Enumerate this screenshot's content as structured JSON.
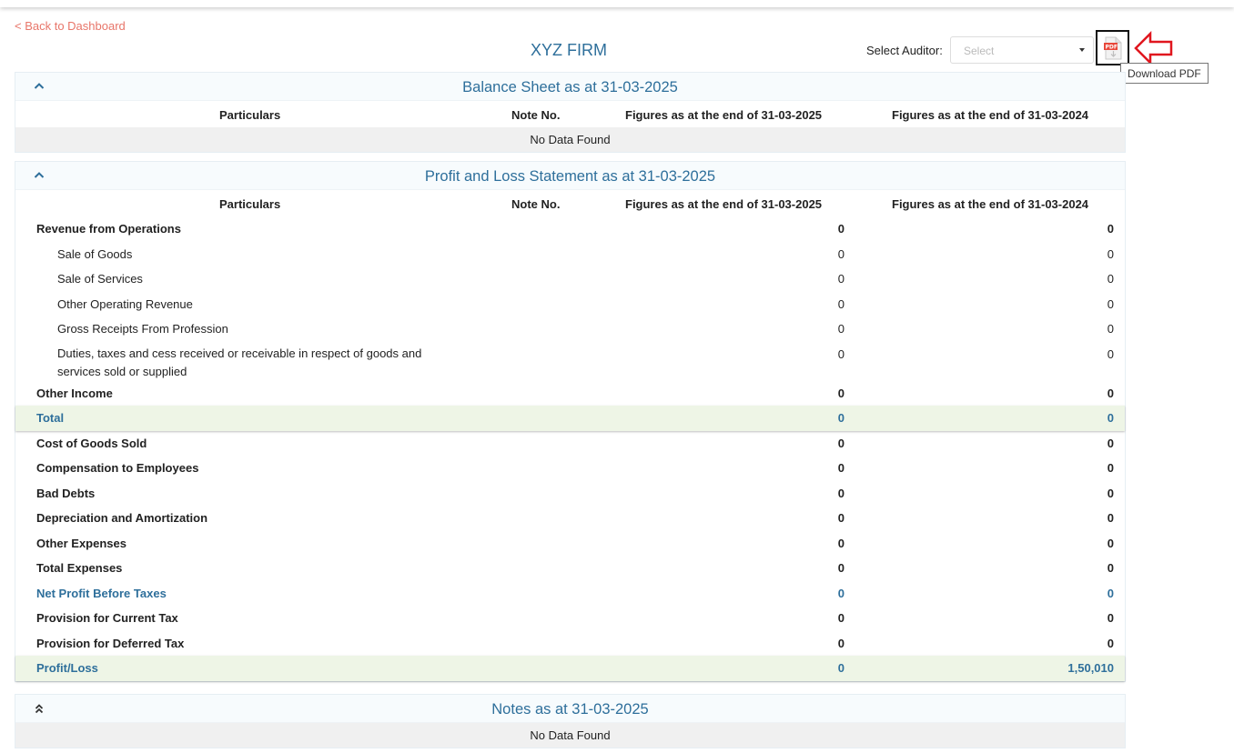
{
  "nav": {
    "back_label": "< Back to Dashboard"
  },
  "header": {
    "firm_name": "XYZ FIRM",
    "auditor_label": "Select Auditor:",
    "auditor_placeholder": "Select",
    "pdf_tooltip": "Download PDF"
  },
  "columns": {
    "particulars": "Particulars",
    "note": "Note No.",
    "fy_current": "Figures as at the end of 31-03-2025",
    "fy_previous": "Figures as at the end of 31-03-2024"
  },
  "balance_sheet": {
    "title": "Balance Sheet as at 31-03-2025",
    "empty_text": "No Data Found"
  },
  "profit_loss": {
    "title": "Profit and Loss Statement as at 31-03-2025",
    "rows": [
      {
        "label": "Revenue from Operations",
        "v1": "0",
        "v2": "0",
        "style": "bold"
      },
      {
        "label": "Sale of Goods",
        "v1": "0",
        "v2": "0",
        "style": "sub"
      },
      {
        "label": "Sale of Services",
        "v1": "0",
        "v2": "0",
        "style": "sub"
      },
      {
        "label": "Other Operating Revenue",
        "v1": "0",
        "v2": "0",
        "style": "sub"
      },
      {
        "label": "Gross Receipts From Profession",
        "v1": "0",
        "v2": "0",
        "style": "sub"
      },
      {
        "label": "Duties, taxes and cess received or receivable in respect of goods and services sold or supplied",
        "v1": "0",
        "v2": "0",
        "style": "sub-tall"
      },
      {
        "label": "Other Income",
        "v1": "0",
        "v2": "0",
        "style": "bold"
      },
      {
        "label": "Total",
        "v1": "0",
        "v2": "0",
        "style": "total"
      },
      {
        "label": "Cost of Goods Sold",
        "v1": "0",
        "v2": "0",
        "style": "bold"
      },
      {
        "label": "Compensation to Employees",
        "v1": "0",
        "v2": "0",
        "style": "bold"
      },
      {
        "label": "Bad Debts",
        "v1": "0",
        "v2": "0",
        "style": "bold"
      },
      {
        "label": "Depreciation and Amortization",
        "v1": "0",
        "v2": "0",
        "style": "bold"
      },
      {
        "label": "Other Expenses",
        "v1": "0",
        "v2": "0",
        "style": "bold"
      },
      {
        "label": "Total Expenses",
        "v1": "0",
        "v2": "0",
        "style": "bold"
      },
      {
        "label": "Net Profit Before Taxes",
        "v1": "0",
        "v2": "0",
        "style": "np"
      },
      {
        "label": "Provision for Current Tax",
        "v1": "0",
        "v2": "0",
        "style": "bold"
      },
      {
        "label": "Provision for Deferred Tax",
        "v1": "0",
        "v2": "0",
        "style": "bold"
      },
      {
        "label": "Profit/Loss",
        "v1": "0",
        "v2": "1,50,010",
        "style": "total"
      }
    ]
  },
  "notes": {
    "title": "Notes as at 31-03-2025",
    "empty_text": "No Data Found"
  },
  "colors": {
    "accent": "#2e6f9b",
    "link": "#e8766a",
    "total_bg": "#eef5e6",
    "annotation_arrow": "#e0161e"
  },
  "icons": {
    "collapse": "chevron-up-icon",
    "expand": "double-chevron-up-icon",
    "pdf": "pdf-download-icon",
    "annotation": "arrow-left-outline-icon"
  }
}
